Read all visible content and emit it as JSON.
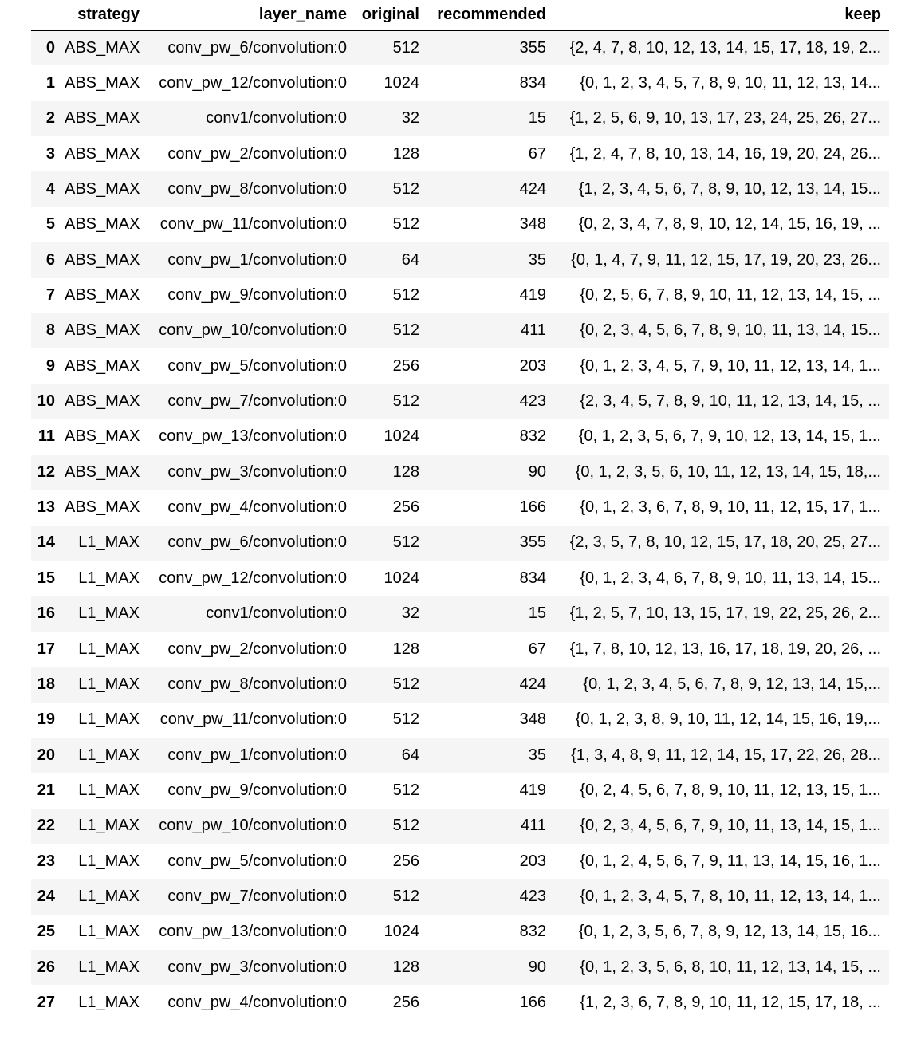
{
  "columns": {
    "index": "",
    "strategy": "strategy",
    "layer_name": "layer_name",
    "original": "original",
    "recommended": "recommended",
    "keep": "keep"
  },
  "rows": [
    {
      "index": "0",
      "strategy": "ABS_MAX",
      "layer_name": "conv_pw_6/convolution:0",
      "original": "512",
      "recommended": "355",
      "keep": "{2, 4, 7, 8, 10, 12, 13, 14, 15, 17, 18, 19, 2..."
    },
    {
      "index": "1",
      "strategy": "ABS_MAX",
      "layer_name": "conv_pw_12/convolution:0",
      "original": "1024",
      "recommended": "834",
      "keep": "{0, 1, 2, 3, 4, 5, 7, 8, 9, 10, 11, 12, 13, 14..."
    },
    {
      "index": "2",
      "strategy": "ABS_MAX",
      "layer_name": "conv1/convolution:0",
      "original": "32",
      "recommended": "15",
      "keep": "{1, 2, 5, 6, 9, 10, 13, 17, 23, 24, 25, 26, 27..."
    },
    {
      "index": "3",
      "strategy": "ABS_MAX",
      "layer_name": "conv_pw_2/convolution:0",
      "original": "128",
      "recommended": "67",
      "keep": "{1, 2, 4, 7, 8, 10, 13, 14, 16, 19, 20, 24, 26..."
    },
    {
      "index": "4",
      "strategy": "ABS_MAX",
      "layer_name": "conv_pw_8/convolution:0",
      "original": "512",
      "recommended": "424",
      "keep": "{1, 2, 3, 4, 5, 6, 7, 8, 9, 10, 12, 13, 14, 15..."
    },
    {
      "index": "5",
      "strategy": "ABS_MAX",
      "layer_name": "conv_pw_11/convolution:0",
      "original": "512",
      "recommended": "348",
      "keep": "{0, 2, 3, 4, 7, 8, 9, 10, 12, 14, 15, 16, 19, ..."
    },
    {
      "index": "6",
      "strategy": "ABS_MAX",
      "layer_name": "conv_pw_1/convolution:0",
      "original": "64",
      "recommended": "35",
      "keep": "{0, 1, 4, 7, 9, 11, 12, 15, 17, 19, 20, 23, 26..."
    },
    {
      "index": "7",
      "strategy": "ABS_MAX",
      "layer_name": "conv_pw_9/convolution:0",
      "original": "512",
      "recommended": "419",
      "keep": "{0, 2, 5, 6, 7, 8, 9, 10, 11, 12, 13, 14, 15, ..."
    },
    {
      "index": "8",
      "strategy": "ABS_MAX",
      "layer_name": "conv_pw_10/convolution:0",
      "original": "512",
      "recommended": "411",
      "keep": "{0, 2, 3, 4, 5, 6, 7, 8, 9, 10, 11, 13, 14, 15..."
    },
    {
      "index": "9",
      "strategy": "ABS_MAX",
      "layer_name": "conv_pw_5/convolution:0",
      "original": "256",
      "recommended": "203",
      "keep": "{0, 1, 2, 3, 4, 5, 7, 9, 10, 11, 12, 13, 14, 1..."
    },
    {
      "index": "10",
      "strategy": "ABS_MAX",
      "layer_name": "conv_pw_7/convolution:0",
      "original": "512",
      "recommended": "423",
      "keep": "{2, 3, 4, 5, 7, 8, 9, 10, 11, 12, 13, 14, 15, ..."
    },
    {
      "index": "11",
      "strategy": "ABS_MAX",
      "layer_name": "conv_pw_13/convolution:0",
      "original": "1024",
      "recommended": "832",
      "keep": "{0, 1, 2, 3, 5, 6, 7, 9, 10, 12, 13, 14, 15, 1..."
    },
    {
      "index": "12",
      "strategy": "ABS_MAX",
      "layer_name": "conv_pw_3/convolution:0",
      "original": "128",
      "recommended": "90",
      "keep": "{0, 1, 2, 3, 5, 6, 10, 11, 12, 13, 14, 15, 18,..."
    },
    {
      "index": "13",
      "strategy": "ABS_MAX",
      "layer_name": "conv_pw_4/convolution:0",
      "original": "256",
      "recommended": "166",
      "keep": "{0, 1, 2, 3, 6, 7, 8, 9, 10, 11, 12, 15, 17, 1..."
    },
    {
      "index": "14",
      "strategy": "L1_MAX",
      "layer_name": "conv_pw_6/convolution:0",
      "original": "512",
      "recommended": "355",
      "keep": "{2, 3, 5, 7, 8, 10, 12, 15, 17, 18, 20, 25, 27..."
    },
    {
      "index": "15",
      "strategy": "L1_MAX",
      "layer_name": "conv_pw_12/convolution:0",
      "original": "1024",
      "recommended": "834",
      "keep": "{0, 1, 2, 3, 4, 6, 7, 8, 9, 10, 11, 13, 14, 15..."
    },
    {
      "index": "16",
      "strategy": "L1_MAX",
      "layer_name": "conv1/convolution:0",
      "original": "32",
      "recommended": "15",
      "keep": "{1, 2, 5, 7, 10, 13, 15, 17, 19, 22, 25, 26, 2..."
    },
    {
      "index": "17",
      "strategy": "L1_MAX",
      "layer_name": "conv_pw_2/convolution:0",
      "original": "128",
      "recommended": "67",
      "keep": "{1, 7, 8, 10, 12, 13, 16, 17, 18, 19, 20, 26, ..."
    },
    {
      "index": "18",
      "strategy": "L1_MAX",
      "layer_name": "conv_pw_8/convolution:0",
      "original": "512",
      "recommended": "424",
      "keep": "{0, 1, 2, 3, 4, 5, 6, 7, 8, 9, 12, 13, 14, 15,..."
    },
    {
      "index": "19",
      "strategy": "L1_MAX",
      "layer_name": "conv_pw_11/convolution:0",
      "original": "512",
      "recommended": "348",
      "keep": "{0, 1, 2, 3, 8, 9, 10, 11, 12, 14, 15, 16, 19,..."
    },
    {
      "index": "20",
      "strategy": "L1_MAX",
      "layer_name": "conv_pw_1/convolution:0",
      "original": "64",
      "recommended": "35",
      "keep": "{1, 3, 4, 8, 9, 11, 12, 14, 15, 17, 22, 26, 28..."
    },
    {
      "index": "21",
      "strategy": "L1_MAX",
      "layer_name": "conv_pw_9/convolution:0",
      "original": "512",
      "recommended": "419",
      "keep": "{0, 2, 4, 5, 6, 7, 8, 9, 10, 11, 12, 13, 15, 1..."
    },
    {
      "index": "22",
      "strategy": "L1_MAX",
      "layer_name": "conv_pw_10/convolution:0",
      "original": "512",
      "recommended": "411",
      "keep": "{0, 2, 3, 4, 5, 6, 7, 9, 10, 11, 13, 14, 15, 1..."
    },
    {
      "index": "23",
      "strategy": "L1_MAX",
      "layer_name": "conv_pw_5/convolution:0",
      "original": "256",
      "recommended": "203",
      "keep": "{0, 1, 2, 4, 5, 6, 7, 9, 11, 13, 14, 15, 16, 1..."
    },
    {
      "index": "24",
      "strategy": "L1_MAX",
      "layer_name": "conv_pw_7/convolution:0",
      "original": "512",
      "recommended": "423",
      "keep": "{0, 1, 2, 3, 4, 5, 7, 8, 10, 11, 12, 13, 14, 1..."
    },
    {
      "index": "25",
      "strategy": "L1_MAX",
      "layer_name": "conv_pw_13/convolution:0",
      "original": "1024",
      "recommended": "832",
      "keep": "{0, 1, 2, 3, 5, 6, 7, 8, 9, 12, 13, 14, 15, 16..."
    },
    {
      "index": "26",
      "strategy": "L1_MAX",
      "layer_name": "conv_pw_3/convolution:0",
      "original": "128",
      "recommended": "90",
      "keep": "{0, 1, 2, 3, 5, 6, 8, 10, 11, 12, 13, 14, 15, ..."
    },
    {
      "index": "27",
      "strategy": "L1_MAX",
      "layer_name": "conv_pw_4/convolution:0",
      "original": "256",
      "recommended": "166",
      "keep": "{1, 2, 3, 6, 7, 8, 9, 10, 11, 12, 15, 17, 18, ..."
    }
  ],
  "colors": {
    "stripe_row": "#f5f5f5",
    "plain_row": "#ffffff",
    "header_rule": "#000000"
  }
}
